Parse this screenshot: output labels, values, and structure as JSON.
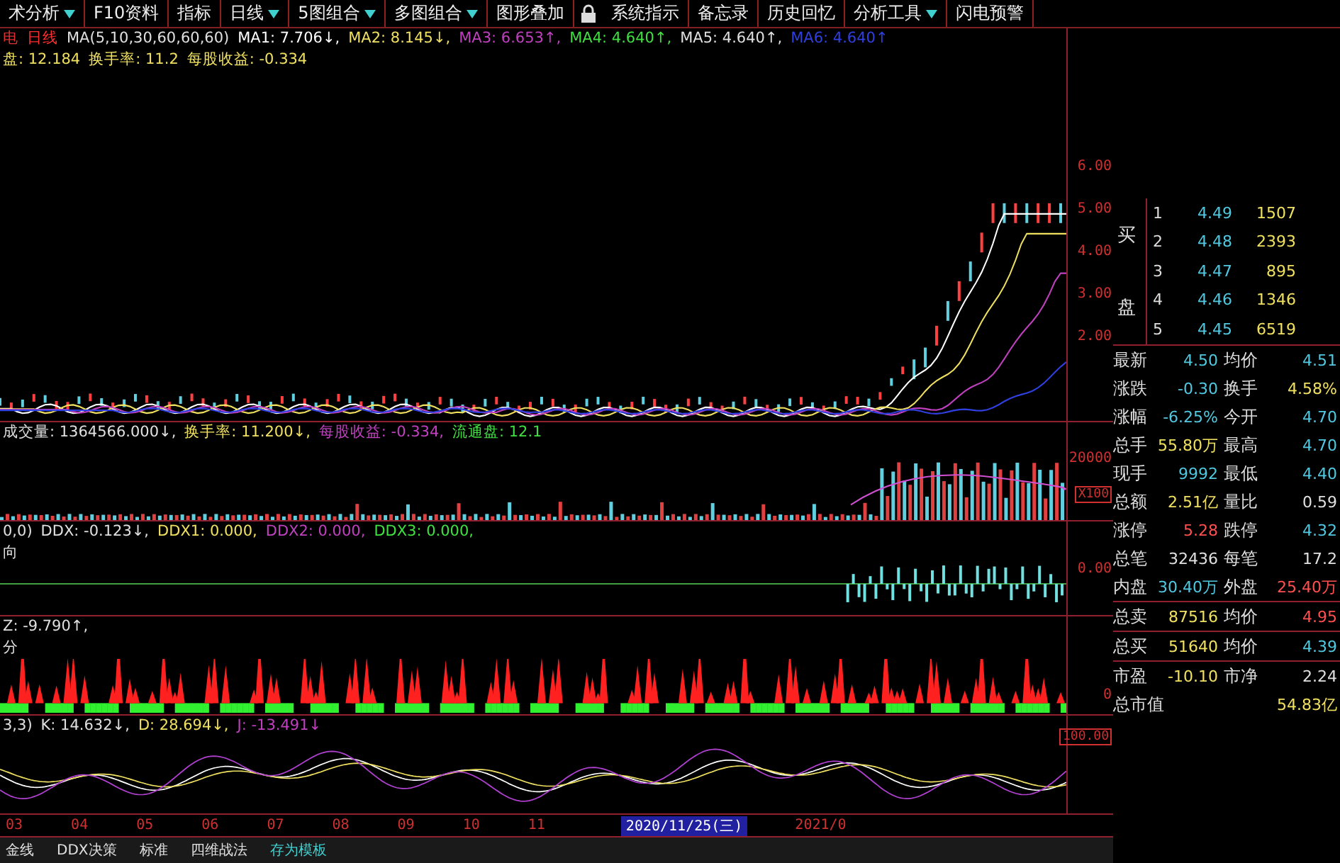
{
  "toolbar": [
    {
      "kind": "button",
      "label": "术分析",
      "dropdown": true
    },
    {
      "kind": "button",
      "label": "F10资料",
      "dropdown": false
    },
    {
      "kind": "button",
      "label": "指标",
      "dropdown": false
    },
    {
      "kind": "button",
      "label": "日线",
      "dropdown": true
    },
    {
      "kind": "button",
      "label": "5图组合",
      "dropdown": true
    },
    {
      "kind": "button",
      "label": "多图组合",
      "dropdown": true
    },
    {
      "kind": "button",
      "label": "图形叠加",
      "dropdown": false
    },
    {
      "kind": "lock"
    },
    {
      "kind": "button",
      "label": "系统指示",
      "dropdown": false
    },
    {
      "kind": "button",
      "label": "备忘录",
      "dropdown": false
    },
    {
      "kind": "button",
      "label": "历史回忆",
      "dropdown": false
    },
    {
      "kind": "button",
      "label": "分析工具",
      "dropdown": true
    },
    {
      "kind": "button",
      "label": "闪电预警",
      "dropdown": false
    }
  ],
  "main_panel": {
    "lines": [
      [
        {
          "text": "电",
          "color": "#e03030"
        },
        {
          "text": "日线",
          "color": "#ff3030"
        },
        {
          "text": "MA(5,10,30,60,60,60)",
          "color": "#e0e0e0"
        },
        {
          "text": "MA1: 7.706↓,",
          "color": "#ffffff"
        },
        {
          "text": "MA2: 8.145↓,",
          "color": "#f0e060"
        },
        {
          "text": "MA3: 6.653↑,",
          "color": "#c040c0"
        },
        {
          "text": "MA4: 4.640↑,",
          "color": "#40e040"
        },
        {
          "text": "MA5: 4.640↑,",
          "color": "#e0e0e0"
        },
        {
          "text": "MA6: 4.640↑",
          "color": "#3040e0"
        }
      ],
      [
        {
          "text": "盘: 12.184",
          "color": "#f0e060"
        },
        {
          "text": "换手率: 11.2",
          "color": "#f0e060"
        },
        {
          "text": "每股收益: -0.334",
          "color": "#f0e060"
        }
      ]
    ],
    "axis": [
      "6.00",
      "5.00",
      "4.00",
      "3.00",
      "2.00"
    ]
  },
  "volume_panel": {
    "lines": [
      [
        {
          "text": "成交量: 1364566.000↓,",
          "color": "#e0e0e0"
        },
        {
          "text": "换手率: 11.200↓,",
          "color": "#f0e060"
        },
        {
          "text": "每股收益: -0.334,",
          "color": "#c040c0"
        },
        {
          "text": "流通盘: 12.1",
          "color": "#40e040"
        }
      ]
    ],
    "axis": [
      "20000",
      "X100"
    ]
  },
  "ddx_panel": {
    "lines": [
      [
        {
          "text": "0,0)",
          "color": "#e0e0e0"
        },
        {
          "text": "DDX: -0.123↓,",
          "color": "#e0e0e0"
        },
        {
          "text": "DDX1: 0.000,",
          "color": "#f0e060"
        },
        {
          "text": "DDX2: 0.000,",
          "color": "#c040c0"
        },
        {
          "text": "DDX3: 0.000,",
          "color": "#40e040"
        }
      ],
      [
        {
          "text": "向",
          "color": "#e0e0e0"
        }
      ]
    ],
    "axis": [
      "0.00"
    ]
  },
  "fund_panel": {
    "lines": [
      [
        {
          "text": "Z: -9.790↑,",
          "color": "#e0e0e0"
        }
      ],
      [
        {
          "text": "分",
          "color": "#e0e0e0"
        }
      ]
    ],
    "axis": [
      "0"
    ]
  },
  "kdj_panel": {
    "lines": [
      [
        {
          "text": "3,3)",
          "color": "#e0e0e0"
        },
        {
          "text": "K: 14.632↓,",
          "color": "#e0e0e0"
        },
        {
          "text": "D: 28.694↓,",
          "color": "#f0e060"
        },
        {
          "text": "J: -13.491↓",
          "color": "#c040c0"
        }
      ]
    ],
    "axis": [
      "100.00"
    ]
  },
  "date_axis": [
    {
      "kind": "tick",
      "label": "03"
    },
    {
      "kind": "tick",
      "label": "04"
    },
    {
      "kind": "tick",
      "label": "05"
    },
    {
      "kind": "tick",
      "label": "06"
    },
    {
      "kind": "tick",
      "label": "07"
    },
    {
      "kind": "tick",
      "label": "08"
    },
    {
      "kind": "tick",
      "label": "09"
    },
    {
      "kind": "tick",
      "label": "10"
    },
    {
      "kind": "tick",
      "label": "11"
    },
    {
      "kind": "cursor",
      "label": "2020/11/25(三)"
    },
    {
      "kind": "tick",
      "label": "2021/0"
    }
  ],
  "bottom_tabs": [
    {
      "label": "金线",
      "color": "#e0e0e0"
    },
    {
      "label": "DDX决策",
      "color": "#e0e0e0"
    },
    {
      "label": "标准",
      "color": "#e0e0e0"
    },
    {
      "label": "四维战法",
      "color": "#e0e0e0"
    },
    {
      "label": "存为模板",
      "color": "#40d0d0"
    }
  ],
  "order_book": {
    "side_label": [
      "买",
      "盘"
    ],
    "rows": [
      {
        "level": "1",
        "price": "4.49",
        "volume": "1507"
      },
      {
        "level": "2",
        "price": "4.48",
        "volume": "2393"
      },
      {
        "level": "3",
        "price": "4.47",
        "volume": "895"
      },
      {
        "level": "4",
        "price": "4.46",
        "volume": "1346"
      },
      {
        "level": "5",
        "price": "4.45",
        "volume": "6519"
      }
    ]
  },
  "quote": [
    {
      "cells": [
        {
          "label": "最新",
          "value": "4.50",
          "color": "#50c8e0"
        },
        {
          "label": "均价",
          "value": "4.51",
          "color": "#50c8e0"
        }
      ],
      "divider_after": false
    },
    {
      "cells": [
        {
          "label": "涨跌",
          "value": "-0.30",
          "color": "#50c8e0"
        },
        {
          "label": "换手",
          "value": "4.58%",
          "color": "#f0e060"
        }
      ],
      "divider_after": false
    },
    {
      "cells": [
        {
          "label": "涨幅",
          "value": "-6.25%",
          "color": "#50c8e0"
        },
        {
          "label": "今开",
          "value": "4.70",
          "color": "#50c8e0"
        }
      ],
      "divider_after": false
    },
    {
      "cells": [
        {
          "label": "总手",
          "value": "55.80万",
          "color": "#f0e060"
        },
        {
          "label": "最高",
          "value": "4.70",
          "color": "#50c8e0"
        }
      ],
      "divider_after": false
    },
    {
      "cells": [
        {
          "label": "现手",
          "value": "9992",
          "color": "#50c8e0"
        },
        {
          "label": "最低",
          "value": "4.40",
          "color": "#50c8e0"
        }
      ],
      "divider_after": false
    },
    {
      "cells": [
        {
          "label": "总额",
          "value": "2.51亿",
          "color": "#f0e060"
        },
        {
          "label": "量比",
          "value": "0.59",
          "color": "#e0e0e0"
        }
      ],
      "divider_after": false
    },
    {
      "cells": [
        {
          "label": "涨停",
          "value": "5.28",
          "color": "#ff5050"
        },
        {
          "label": "跌停",
          "value": "4.32",
          "color": "#50c8e0"
        }
      ],
      "divider_after": false
    },
    {
      "cells": [
        {
          "label": "总笔",
          "value": "32436",
          "color": "#e0e0e0"
        },
        {
          "label": "每笔",
          "value": "17.2",
          "color": "#e0e0e0"
        }
      ],
      "divider_after": false
    },
    {
      "cells": [
        {
          "label": "内盘",
          "value": "30.40万",
          "color": "#50c8e0"
        },
        {
          "label": "外盘",
          "value": "25.40万",
          "color": "#ff5050"
        }
      ],
      "divider_after": true
    },
    {
      "cells": [
        {
          "label": "总卖",
          "value": "87516",
          "color": "#f0e060"
        },
        {
          "label": "均价",
          "value": "4.95",
          "color": "#ff5050"
        }
      ],
      "divider_after": true
    },
    {
      "cells": [
        {
          "label": "总买",
          "value": "51640",
          "color": "#f0e060"
        },
        {
          "label": "均价",
          "value": "4.39",
          "color": "#50c8e0"
        }
      ],
      "divider_after": true
    },
    {
      "cells": [
        {
          "label": "市盈",
          "value": "-10.10",
          "color": "#f0e060"
        },
        {
          "label": "市净",
          "value": "2.24",
          "color": "#e0e0e0"
        }
      ],
      "divider_after": false
    },
    {
      "cells": [
        {
          "label": "总市值",
          "value": "54.83亿",
          "color": "#f0e060"
        }
      ],
      "divider_after": false
    }
  ]
}
